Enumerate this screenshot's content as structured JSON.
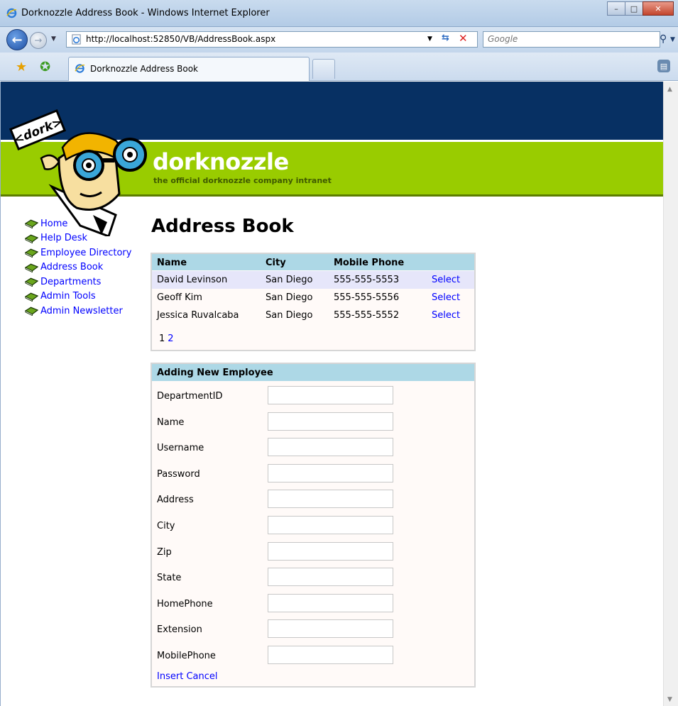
{
  "window": {
    "title": "Dorknozzle Address Book - Windows Internet Explorer",
    "minimize": "–",
    "maximize": "□",
    "close": "✕"
  },
  "addressbar": {
    "url": "http://localhost:52850/VB/AddressBook.aspx",
    "search_placeholder": "Google"
  },
  "tabs": [
    {
      "label": "Dorknozzle Address Book"
    }
  ],
  "site": {
    "brand": "dorknozzle",
    "tagline": "the official dorknozzle company intranet",
    "mascot_sign": "<dork>"
  },
  "nav": {
    "items": [
      {
        "label": "Home"
      },
      {
        "label": "Help Desk"
      },
      {
        "label": "Employee Directory"
      },
      {
        "label": "Address Book"
      },
      {
        "label": "Departments"
      },
      {
        "label": "Admin Tools"
      },
      {
        "label": "Admin Newsletter"
      }
    ]
  },
  "page": {
    "title": "Address Book"
  },
  "grid": {
    "columns": [
      "Name",
      "City",
      "Mobile Phone"
    ],
    "rows": [
      {
        "name": "David Levinson",
        "city": "San Diego",
        "phone": "555-555-5553",
        "action": "Select"
      },
      {
        "name": "Geoff Kim",
        "city": "San Diego",
        "phone": "555-555-5556",
        "action": "Select"
      },
      {
        "name": "Jessica Ruvalcaba",
        "city": "San Diego",
        "phone": "555-555-5552",
        "action": "Select"
      }
    ],
    "pager": {
      "current": "1",
      "next": "2"
    }
  },
  "form": {
    "header": "Adding New Employee",
    "fields": [
      {
        "label": "DepartmentID",
        "value": ""
      },
      {
        "label": "Name",
        "value": ""
      },
      {
        "label": "Username",
        "value": ""
      },
      {
        "label": "Password",
        "value": ""
      },
      {
        "label": "Address",
        "value": ""
      },
      {
        "label": "City",
        "value": ""
      },
      {
        "label": "Zip",
        "value": ""
      },
      {
        "label": "State",
        "value": ""
      },
      {
        "label": "HomePhone",
        "value": ""
      },
      {
        "label": "Extension",
        "value": ""
      },
      {
        "label": "MobilePhone",
        "value": ""
      }
    ],
    "insert_label": "Insert",
    "cancel_label": "Cancel"
  },
  "colors": {
    "navy": "#073063",
    "green": "#99cc00",
    "grid_header": "#add8e6",
    "selected_row": "#e6e6fa",
    "link": "#0000ff"
  }
}
